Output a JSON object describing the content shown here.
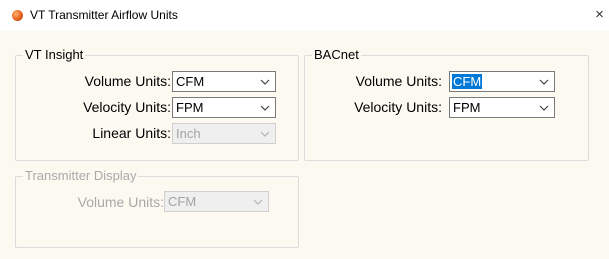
{
  "window": {
    "title": "VT Transmitter Airflow Units",
    "close_glyph": "×",
    "icon": "app-orb-icon"
  },
  "vt_insight": {
    "legend": "VT Insight",
    "volume_units": {
      "label": "Volume Units:",
      "value": "CFM"
    },
    "velocity_units": {
      "label": "Velocity Units:",
      "value": "FPM"
    },
    "linear_units": {
      "label": "Linear Units:",
      "value": "Inch",
      "disabled": true
    }
  },
  "bacnet": {
    "legend": "BACnet",
    "volume_units": {
      "label": "Volume Units:",
      "value": "CFM",
      "highlighted": true
    },
    "velocity_units": {
      "label": "Velocity Units:",
      "value": "FPM"
    }
  },
  "transmitter_display": {
    "legend": "Transmitter Display",
    "disabled": true,
    "volume_units": {
      "label": "Volume Units:",
      "value": "CFM",
      "disabled": true
    }
  },
  "colors": {
    "client_bg": "#fcf9f1",
    "selection": "#0078d7",
    "disabled_text": "#a9a9a9"
  }
}
